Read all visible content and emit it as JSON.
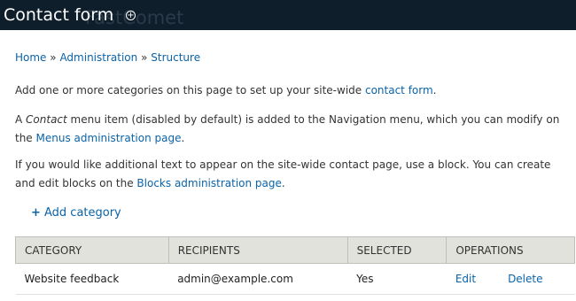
{
  "header": {
    "title": "Contact form",
    "watermark": "FastComet"
  },
  "breadcrumb": [
    "Home",
    "Administration",
    "Structure"
  ],
  "intro": {
    "p1_text": "Add one or more categories on this page to set up your site-wide ",
    "p1_link": "contact form",
    "p1_end": ".",
    "p2_text1": "A ",
    "p2_em": "Contact",
    "p2_text2": " menu item (disabled by default) is added to the Navigation menu, which you can modify on the ",
    "p2_link": "Menus administration page",
    "p2_end": ".",
    "p3_text": "If you would like additional text to appear on the site-wide contact page, use a block. You can create and edit blocks on the ",
    "p3_link": "Blocks administration page",
    "p3_end": "."
  },
  "action": {
    "label": "Add category"
  },
  "table": {
    "headers": [
      "Category",
      "Recipients",
      "Selected",
      "Operations"
    ],
    "rows": [
      {
        "category": "Website feedback",
        "recipients": "admin@example.com",
        "selected": "Yes",
        "edit": "Edit",
        "delete": "Delete"
      }
    ]
  },
  "colors": {
    "header_bg": "#0f1e2b",
    "link": "#0a63a8",
    "table_header_bg": "#e1e2dc"
  }
}
